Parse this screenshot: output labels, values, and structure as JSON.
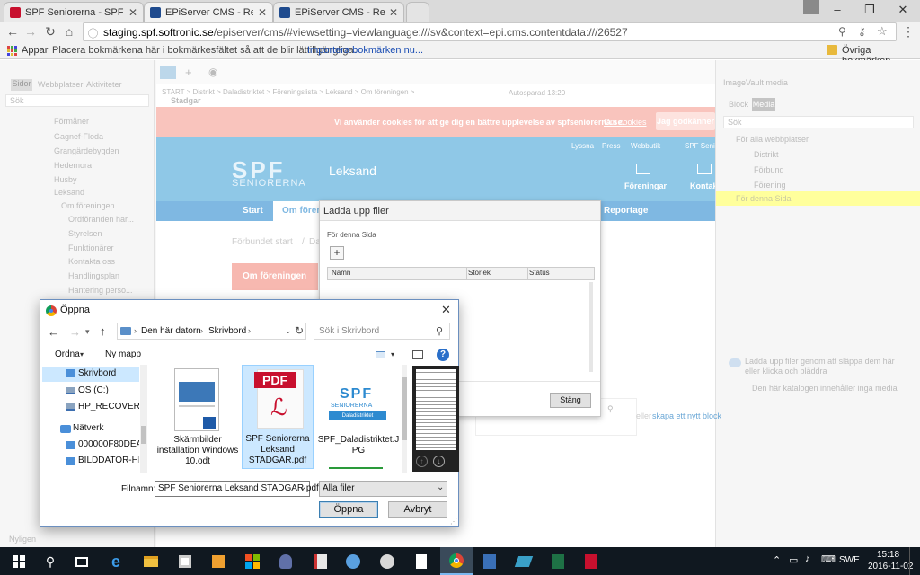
{
  "browser": {
    "tabs": [
      {
        "title": "SPF Seniorerna - SPF Se",
        "favicon_color": "#c8102e"
      },
      {
        "title": "EPiServer CMS - Redigera",
        "favicon_color": "#1f4b8e"
      },
      {
        "title": "EPiServer CMS - Redigera",
        "favicon_color": "#1f4b8e"
      }
    ],
    "url_host": "staging.spf.softronic.se",
    "url_rest": "/episerver/cms/#viewsetting=viewlanguage:///sv&context=epi.cms.contentdata:///26527",
    "bookmarks": {
      "apps_label": "Appar",
      "hint": "Placera bokmärkena här i bokmärkesfältet så att de blir lättillgängliga.",
      "import_link": "Importera bokmärken nu...",
      "other_label": "Övriga bokmärken"
    }
  },
  "cms": {
    "left_tabs": [
      "Sidor",
      "Webbplatser",
      "Aktiviteter"
    ],
    "search_placeholder": "Sök",
    "tree": [
      "Förmåner",
      "Gagnef-Floda",
      "Grangärdebygden",
      "Hedemora",
      "Husby",
      "Leksand",
      "Om föreningen",
      "Ordföranden har...",
      "Styrelsen",
      "Funktionärer",
      "Kontakta oss",
      "Handlingsplan",
      "Hantering perso..."
    ],
    "breadcrumb": "START > Distrikt > Daladistriktet > Föreningslista > Leksand > Om föreningen >",
    "page_name": "Stadgar",
    "autosave": "Autosparad 13:20",
    "cookie_text": "Vi använder cookies för att ge dig en bättre upplevelse av spfseniorerna.se.",
    "cookie_link": "Om cookies",
    "cookie_button": "Jag godkänner",
    "top_links": [
      "Lyssna",
      "Press",
      "Webbutik",
      "SPF Seni"
    ],
    "logo": "SENIORERNA",
    "site_title": "Leksand",
    "header_items": [
      "Föreningar",
      "Kontakt"
    ],
    "menu": [
      "Start",
      "Om förening",
      "Reportage"
    ],
    "breadcrumb2": [
      "Förbundet start",
      "/",
      "Da"
    ],
    "side_button": "Om föreningen",
    "right_title": "ImageVault media",
    "right_tabs": [
      "Block",
      "Media"
    ],
    "right_tree": [
      "För alla webbplatser",
      "Distrikt",
      "Förbund",
      "Förening",
      "För denna Sida"
    ],
    "drop_hint": "Ladda upp filer genom att släppa dem här eller klicka och bläddra",
    "empty_text": "Den här katalogen innehåller inga media",
    "right_link_prefix": "eller",
    "right_link": "skapa ett nytt block",
    "bottom_left": "Nyligen"
  },
  "upload_dialog": {
    "title": "Ladda upp filer",
    "target": "För denna Sida",
    "add_label": "+",
    "columns": [
      "Namn",
      "Storlek",
      "Status"
    ],
    "close_button": "Stäng"
  },
  "open_dialog": {
    "title": "Öppna",
    "path": [
      "Den här datorn",
      "Skrivbord"
    ],
    "search_placeholder": "Sök i Skrivbord",
    "organize": "Ordna",
    "new_folder": "Ny mapp",
    "nav_items": [
      {
        "label": "Skrivbord",
        "icon": "folder-icon"
      },
      {
        "label": "OS (C:)",
        "icon": "drive-icon"
      },
      {
        "label": "HP_RECOVERY (D",
        "icon": "drive-icon"
      },
      {
        "label": "Nätverk",
        "icon": "network-icon"
      },
      {
        "label": "000000F80DEA",
        "icon": "computer-icon"
      },
      {
        "label": "BILDDATOR-HP",
        "icon": "computer-icon"
      }
    ],
    "files": [
      {
        "name": "Skärmbilder installation Windows 10.odt",
        "type": "document"
      },
      {
        "name": "SPF Seniorerna Leksand STADGAR.pdf",
        "type": "pdf",
        "badge": "PDF"
      },
      {
        "name": "SPF_Daladistriktet.JPG",
        "type": "image",
        "thumb_text": "SENIORERNA",
        "thumb_sub": "Daladistriktet"
      }
    ],
    "filename_label": "Filnamn:",
    "filename_value": "SPF Seniorerna Leksand STADGAR.pdf",
    "filter_value": "Alla filer",
    "open_button": "Öppna",
    "cancel_button": "Avbryt"
  },
  "taskbar": {
    "time": "15:18",
    "date": "2016-11-02",
    "lang": "SWE"
  },
  "colors": {
    "accent": "#3c7fb1",
    "cookie_bar": "#f9c4bd",
    "site_header": "#8fc8e7",
    "menu": "#2d8ad0",
    "button_red": "#e8534d",
    "highlight": "#ffff9c"
  }
}
